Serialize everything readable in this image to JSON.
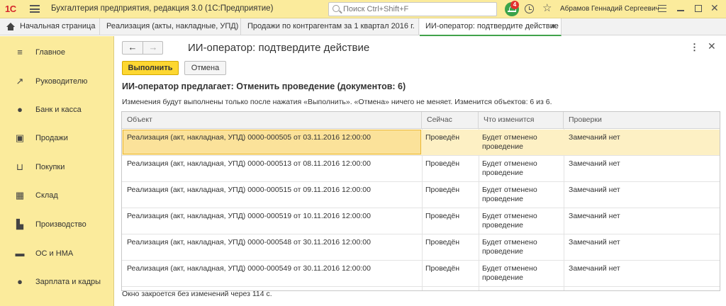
{
  "titlebar": {
    "logo": "1С",
    "app_title": "Бухгалтерия предприятия, редакция 3.0  (1С:Предприятие)",
    "search_placeholder": "Поиск Ctrl+Shift+F",
    "notification_count": "4",
    "user_name": "Абрамов Геннадий Сергеевич"
  },
  "tabs": {
    "home": "Начальная страница",
    "items": [
      {
        "label": "Реализация (акты, накладные, УПД)"
      },
      {
        "label": "Продажи по контрагентам за 1 квартал 2016 г."
      },
      {
        "label": "ИИ-оператор: подтвердите действие",
        "active": true
      }
    ],
    "close_glyph": "×"
  },
  "sidebar": {
    "items": [
      {
        "label": "Главное",
        "icon": "menu-icon"
      },
      {
        "label": "Руководителю",
        "icon": "trend-icon"
      },
      {
        "label": "Банк и касса",
        "icon": "coin-icon"
      },
      {
        "label": "Продажи",
        "icon": "bag-icon"
      },
      {
        "label": "Покупки",
        "icon": "cart-icon"
      },
      {
        "label": "Склад",
        "icon": "grid-icon"
      },
      {
        "label": "Производство",
        "icon": "factory-icon"
      },
      {
        "label": "ОС и НМА",
        "icon": "truck-icon"
      },
      {
        "label": "Зарплата и кадры",
        "icon": "person-icon"
      }
    ]
  },
  "page": {
    "title": "ИИ-оператор: подтвердите действие",
    "execute_label": "Выполнить",
    "cancel_label": "Отмена",
    "subtitle": "ИИ-оператор предлагает: Отменить проведение (документов: 6)",
    "info": "Изменения будут выполнены только после нажатия «Выполнить». «Отмена» ничего не меняет. Изменится объектов: 6 из 6.",
    "footer": "Окно закроется без изменений через 114 с."
  },
  "table": {
    "headers": [
      "Объект",
      "Сейчас",
      "Что изменится",
      "Проверки"
    ],
    "rows": [
      {
        "object": "Реализация (акт, накладная, УПД) 0000-000505 от 03.11.2016 12:00:00",
        "now": "Проведён",
        "change": "Будет отменено проведение",
        "check": "Замечаний нет"
      },
      {
        "object": "Реализация (акт, накладная, УПД) 0000-000513 от 08.11.2016 12:00:00",
        "now": "Проведён",
        "change": "Будет отменено проведение",
        "check": "Замечаний нет"
      },
      {
        "object": "Реализация (акт, накладная, УПД) 0000-000515 от 09.11.2016 12:00:00",
        "now": "Проведён",
        "change": "Будет отменено проведение",
        "check": "Замечаний нет"
      },
      {
        "object": "Реализация (акт, накладная, УПД) 0000-000519 от 10.11.2016 12:00:00",
        "now": "Проведён",
        "change": "Будет отменено проведение",
        "check": "Замечаний нет"
      },
      {
        "object": "Реализация (акт, накладная, УПД) 0000-000548 от 30.11.2016 12:00:00",
        "now": "Проведён",
        "change": "Будет отменено проведение",
        "check": "Замечаний нет"
      },
      {
        "object": "Реализация (акт, накладная, УПД) 0000-000549 от 30.11.2016 12:00:00",
        "now": "Проведён",
        "change": "Будет отменено проведение",
        "check": "Замечаний нет"
      }
    ]
  },
  "colors": {
    "accent_yellow": "#fbeb9c",
    "button_primary": "#fdd731",
    "active_tab_underline": "#41a34b",
    "selected_row": "#fdf0c4"
  }
}
